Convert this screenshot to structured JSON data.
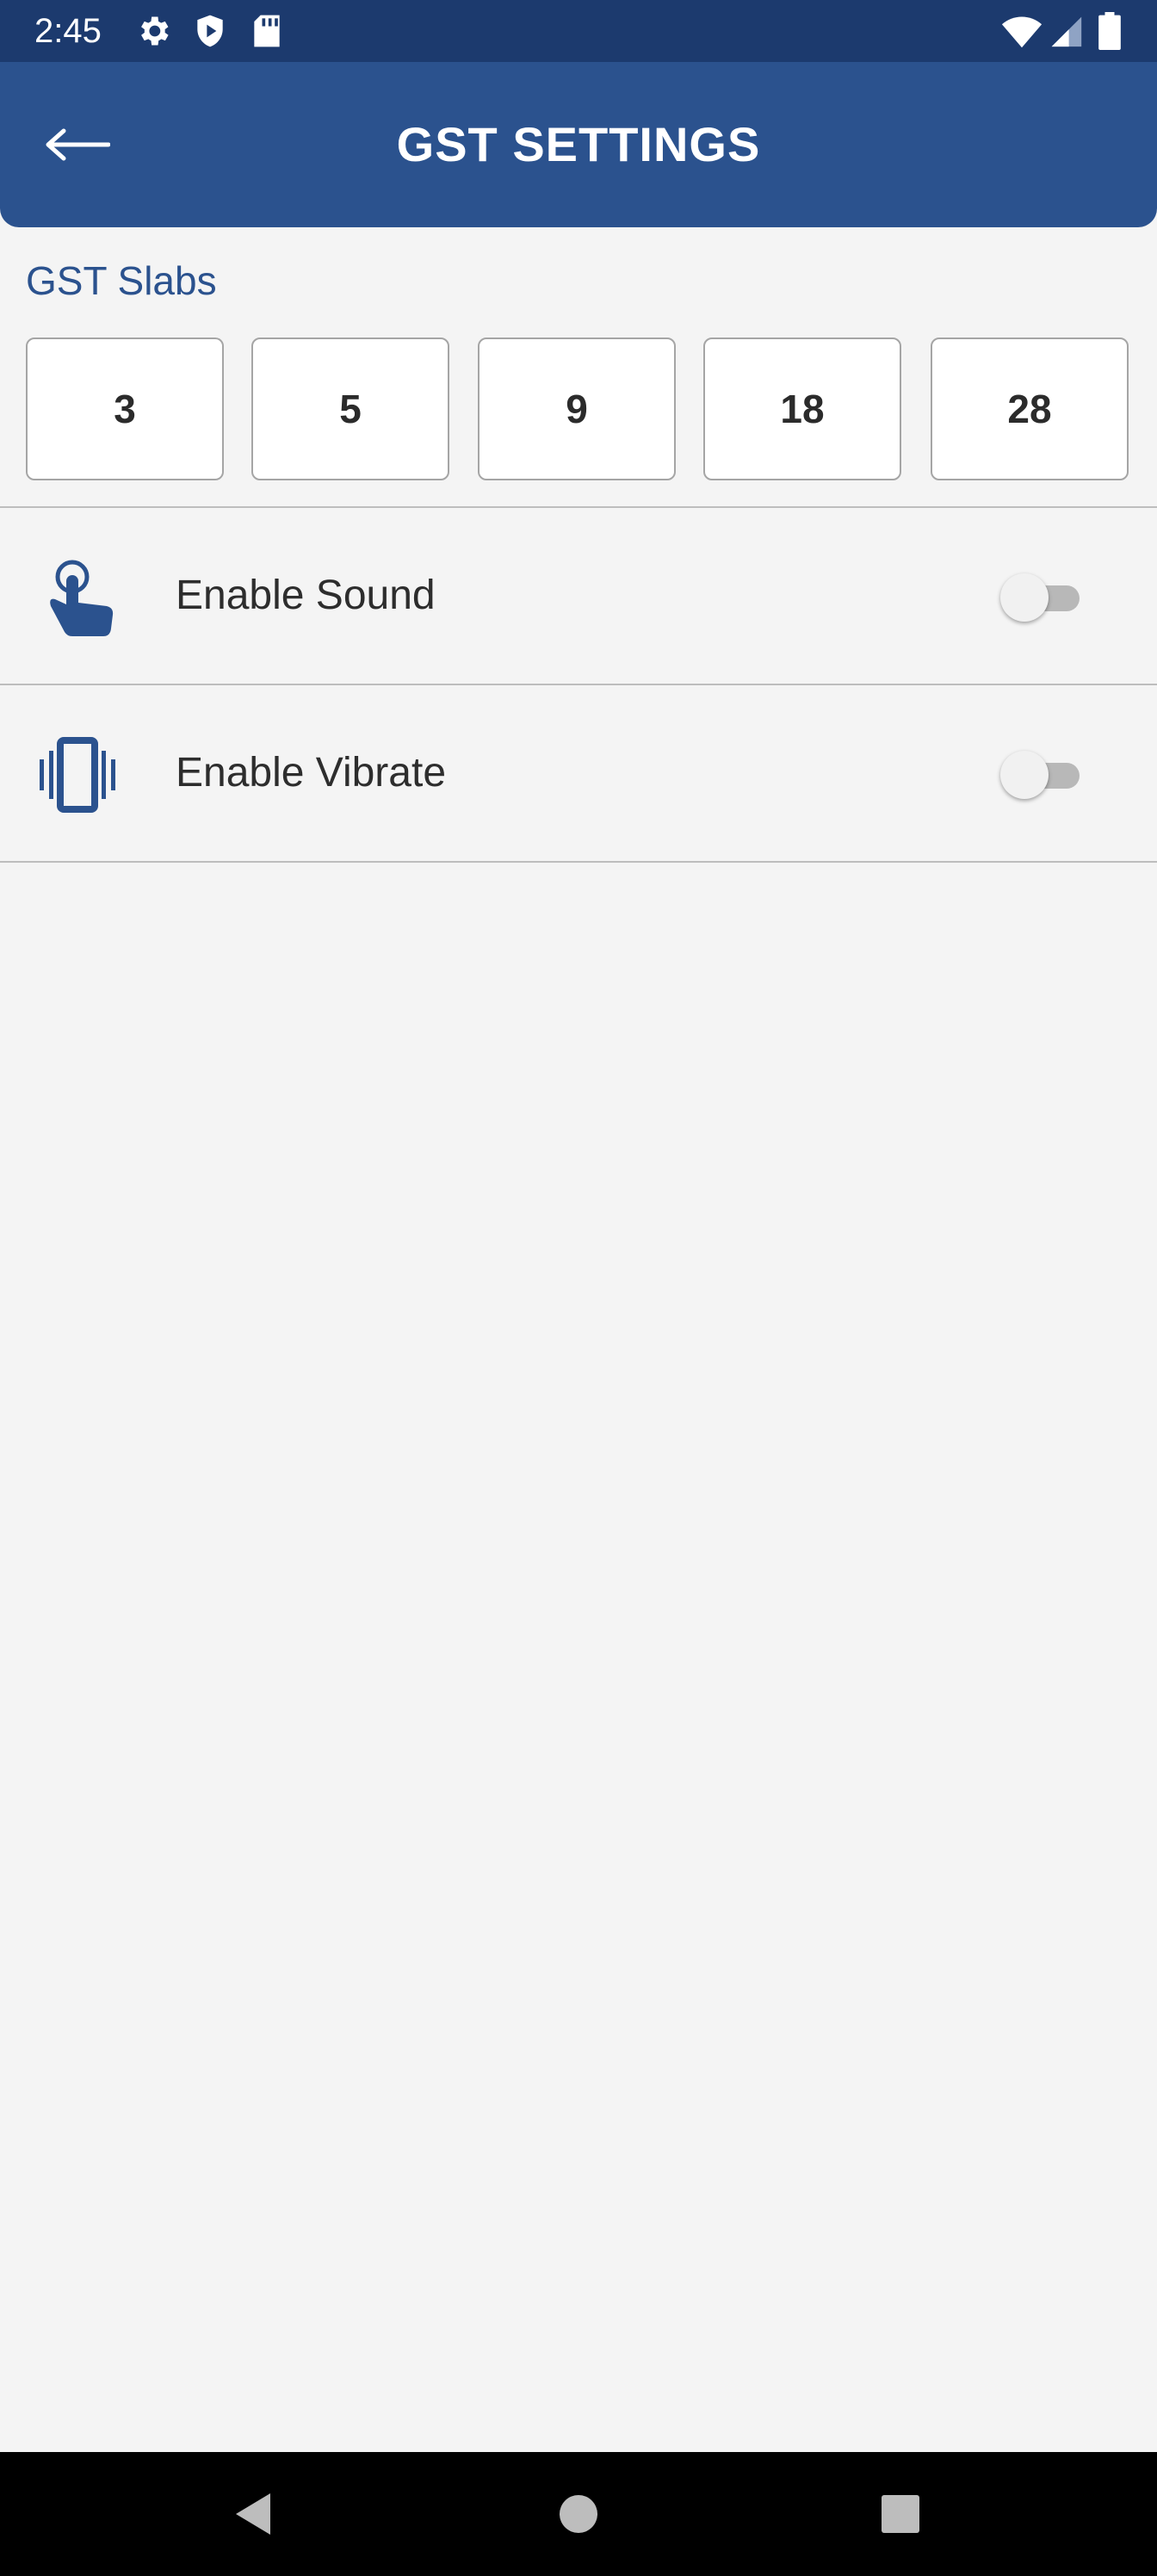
{
  "status_bar": {
    "time": "2:45",
    "left_icons": [
      "gear-icon",
      "shield-play-icon",
      "sd-card-icon"
    ],
    "right_icons": [
      "wifi-icon",
      "cell-signal-icon",
      "battery-icon"
    ]
  },
  "app_bar": {
    "title": "GST SETTINGS",
    "back_icon": "arrow-left-icon",
    "background": "#2b528e"
  },
  "gst_slabs": {
    "label": "GST Slabs",
    "values": [
      "3",
      "5",
      "9",
      "18",
      "28"
    ]
  },
  "settings": [
    {
      "label": "Enable Sound",
      "icon": "touch-hand-icon",
      "enabled": false
    },
    {
      "label": "Enable Vibrate",
      "icon": "vibrate-icon",
      "enabled": false
    }
  ],
  "nav_bar": {
    "buttons": [
      "back-triangle-icon",
      "home-circle-icon",
      "recents-square-icon"
    ]
  },
  "colors": {
    "accent": "#2b528e",
    "status_bar": "#1c3a6e",
    "background": "#f4f4f4"
  }
}
